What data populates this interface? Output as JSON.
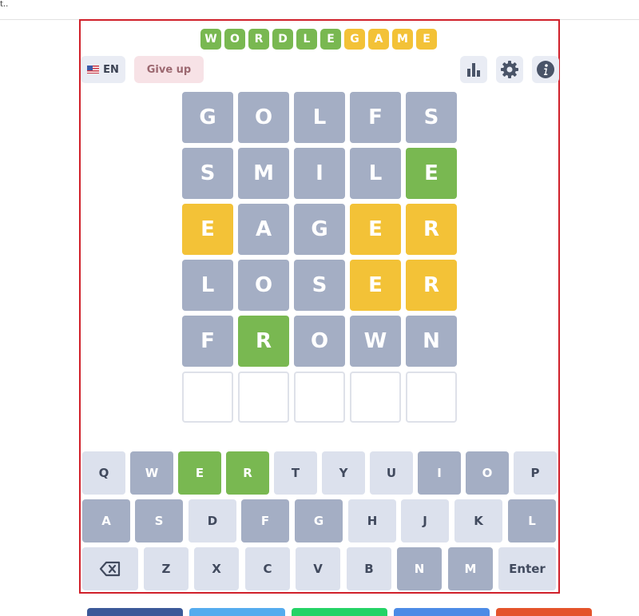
{
  "page": {
    "top_text": "t.."
  },
  "logo": {
    "letters": [
      "W",
      "O",
      "R",
      "D",
      "L",
      "E",
      "G",
      "A",
      "M",
      "E"
    ],
    "colors": [
      "#79b851",
      "#79b851",
      "#79b851",
      "#79b851",
      "#79b851",
      "#79b851",
      "#f3c237",
      "#f3c237",
      "#f3c237",
      "#f3c237"
    ]
  },
  "header": {
    "language": "EN",
    "give_up": "Give up",
    "icons": [
      "bar-chart-icon",
      "gear-icon",
      "info-icon"
    ]
  },
  "board": {
    "rows": [
      [
        {
          "l": "G",
          "s": "gray"
        },
        {
          "l": "O",
          "s": "gray"
        },
        {
          "l": "L",
          "s": "gray"
        },
        {
          "l": "F",
          "s": "gray"
        },
        {
          "l": "S",
          "s": "gray"
        }
      ],
      [
        {
          "l": "S",
          "s": "gray"
        },
        {
          "l": "M",
          "s": "gray"
        },
        {
          "l": "I",
          "s": "gray"
        },
        {
          "l": "L",
          "s": "gray"
        },
        {
          "l": "E",
          "s": "green"
        }
      ],
      [
        {
          "l": "E",
          "s": "yellow"
        },
        {
          "l": "A",
          "s": "gray"
        },
        {
          "l": "G",
          "s": "gray"
        },
        {
          "l": "E",
          "s": "yellow"
        },
        {
          "l": "R",
          "s": "yellow"
        }
      ],
      [
        {
          "l": "L",
          "s": "gray"
        },
        {
          "l": "O",
          "s": "gray"
        },
        {
          "l": "S",
          "s": "gray"
        },
        {
          "l": "E",
          "s": "yellow"
        },
        {
          "l": "R",
          "s": "yellow"
        }
      ],
      [
        {
          "l": "F",
          "s": "gray"
        },
        {
          "l": "R",
          "s": "green"
        },
        {
          "l": "O",
          "s": "gray"
        },
        {
          "l": "W",
          "s": "gray"
        },
        {
          "l": "N",
          "s": "gray"
        }
      ],
      [
        {
          "l": "",
          "s": "empty"
        },
        {
          "l": "",
          "s": "empty"
        },
        {
          "l": "",
          "s": "empty"
        },
        {
          "l": "",
          "s": "empty"
        },
        {
          "l": "",
          "s": "empty"
        }
      ]
    ]
  },
  "keyboard": {
    "rows": [
      [
        {
          "k": "Q",
          "s": "unused"
        },
        {
          "k": "W",
          "s": "absent"
        },
        {
          "k": "E",
          "s": "correct"
        },
        {
          "k": "R",
          "s": "correct"
        },
        {
          "k": "T",
          "s": "unused"
        },
        {
          "k": "Y",
          "s": "unused"
        },
        {
          "k": "U",
          "s": "unused"
        },
        {
          "k": "I",
          "s": "absent"
        },
        {
          "k": "O",
          "s": "absent"
        },
        {
          "k": "P",
          "s": "unused"
        }
      ],
      [
        {
          "k": "A",
          "s": "absent"
        },
        {
          "k": "S",
          "s": "absent"
        },
        {
          "k": "D",
          "s": "unused"
        },
        {
          "k": "F",
          "s": "absent"
        },
        {
          "k": "G",
          "s": "absent"
        },
        {
          "k": "H",
          "s": "unused"
        },
        {
          "k": "J",
          "s": "unused"
        },
        {
          "k": "K",
          "s": "unused"
        },
        {
          "k": "L",
          "s": "absent"
        }
      ],
      [
        {
          "k": "",
          "s": "unused",
          "icon": "backspace-icon"
        },
        {
          "k": "Z",
          "s": "unused"
        },
        {
          "k": "X",
          "s": "unused"
        },
        {
          "k": "C",
          "s": "unused"
        },
        {
          "k": "V",
          "s": "unused"
        },
        {
          "k": "B",
          "s": "unused"
        },
        {
          "k": "N",
          "s": "absent"
        },
        {
          "k": "M",
          "s": "absent"
        },
        {
          "k": "Enter",
          "s": "unused"
        }
      ]
    ]
  },
  "share_colors": [
    "#3b5998",
    "#55acee",
    "#25d366",
    "#4c8be6",
    "#e4542b"
  ]
}
